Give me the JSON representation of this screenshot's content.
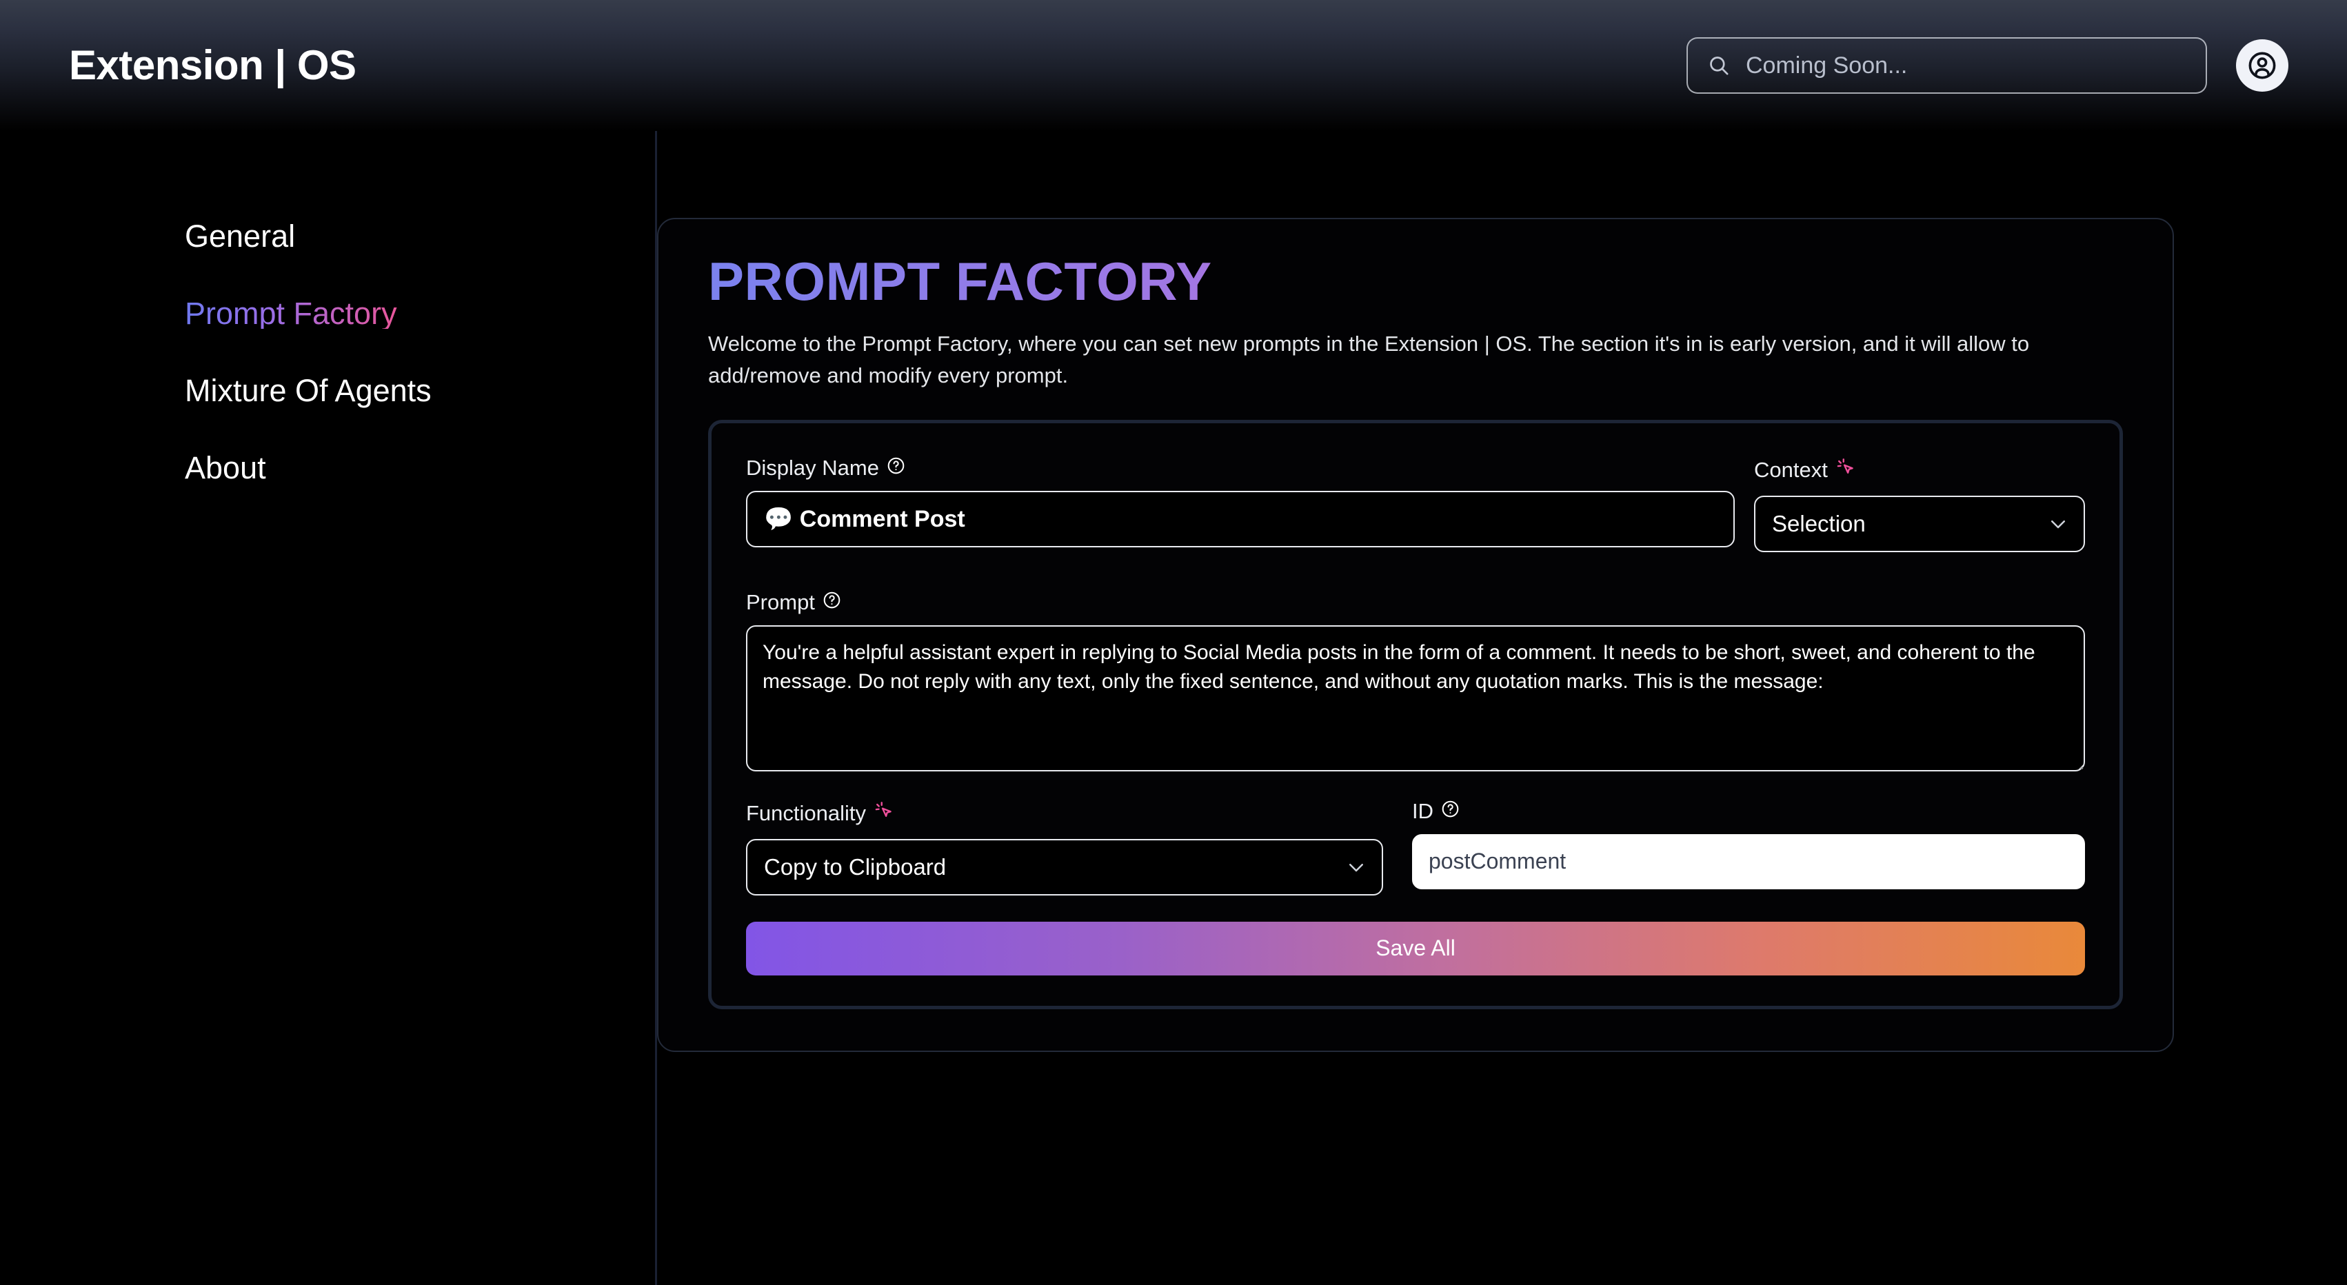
{
  "header": {
    "brand": "Extension | OS",
    "search": {
      "placeholder": "Coming Soon...",
      "value": "",
      "icon": "search-icon"
    },
    "avatar_icon": "user-circle-icon"
  },
  "sidebar": {
    "items": [
      {
        "label": "General",
        "active": false
      },
      {
        "label": "Prompt Factory",
        "active": true
      },
      {
        "label": "Mixture Of Agents",
        "active": false
      },
      {
        "label": "About",
        "active": false
      }
    ]
  },
  "main": {
    "heading": "PROMPT FACTORY",
    "description": "Welcome to the Prompt Factory, where you can set new prompts in the Extension | OS. The section it's in is early version, and it will allow to add/remove and modify every prompt.",
    "form": {
      "display_name": {
        "label": "Display Name",
        "help_icon": "question-circle-icon",
        "value": "💬 Comment Post"
      },
      "context": {
        "label": "Context",
        "marker_icon": "cursor-click-icon",
        "selected": "Selection",
        "chevron_icon": "chevron-down-icon"
      },
      "prompt": {
        "label": "Prompt",
        "help_icon": "question-circle-icon",
        "value": "You're a helpful assistant expert in replying to Social Media posts in the form of a comment. It needs to be short, sweet, and coherent to the message. Do not reply with any text, only the fixed sentence, and without any quotation marks. This is the message:"
      },
      "functionality": {
        "label": "Functionality",
        "marker_icon": "cursor-click-icon",
        "selected": "Copy to Clipboard",
        "chevron_icon": "chevron-down-icon"
      },
      "id": {
        "label": "ID",
        "help_icon": "question-circle-icon",
        "value": "postComment"
      },
      "save_label": "Save All"
    }
  },
  "colors": {
    "accent_purple": "#7b82ee",
    "accent_pink": "#f2689a",
    "accent_orange": "#e9893a",
    "card_border": "#1d2536",
    "background": "#000000"
  }
}
